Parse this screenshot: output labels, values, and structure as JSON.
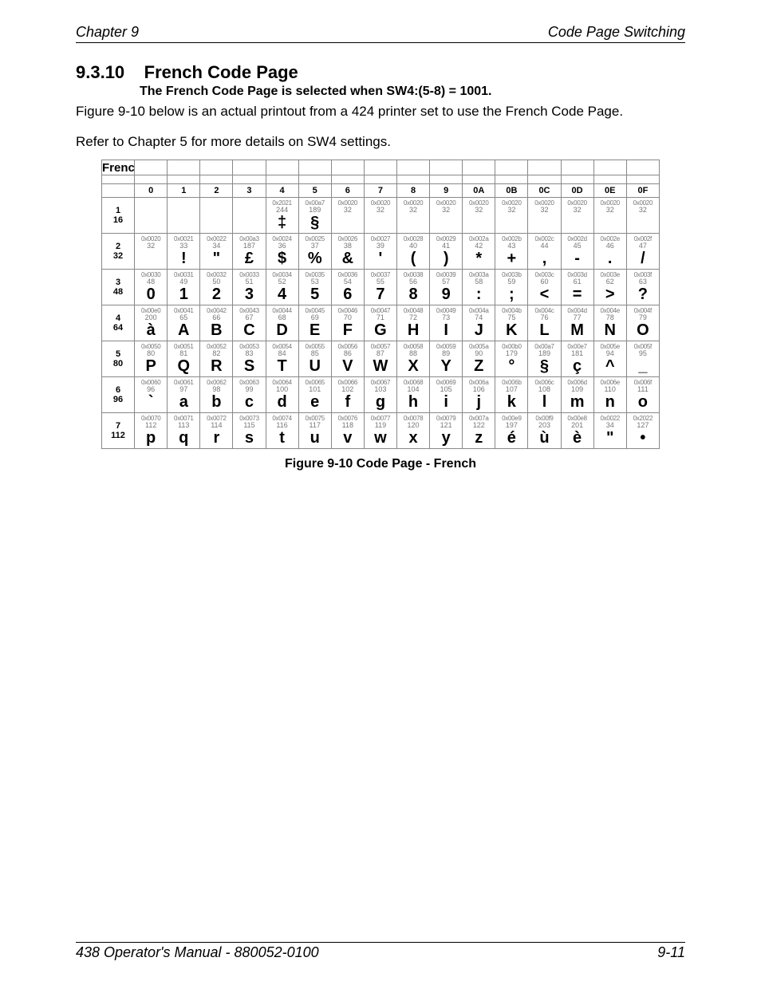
{
  "header": {
    "left": "Chapter 9",
    "right": "Code Page Switching"
  },
  "footer": {
    "left": "438 Operator's Manual - 880052-0100",
    "right": "9-11"
  },
  "section": {
    "number": "9.3.10",
    "title": "French Code Page",
    "subtitle": "The French Code Page is selected when SW4:(5-8) = 1001.",
    "para1": "Figure 9-10 below is an actual printout from a 424 printer set to use the French Code Page.",
    "para2": "Refer to Chapter 5 for more details on SW4 settings."
  },
  "table": {
    "title": "French",
    "col_headers": [
      "0",
      "1",
      "2",
      "3",
      "4",
      "5",
      "6",
      "7",
      "8",
      "9",
      "0A",
      "0B",
      "0C",
      "0D",
      "0E",
      "0F"
    ],
    "rows": [
      {
        "n1": "1",
        "n2": "16",
        "cells": [
          null,
          null,
          null,
          null,
          {
            "hex": "0x2021",
            "dec": "244",
            "g": "‡"
          },
          {
            "hex": "0x00a7",
            "dec": "189",
            "g": "§"
          },
          {
            "hex": "0x0020",
            "dec": "32",
            "g": " "
          },
          {
            "hex": "0x0020",
            "dec": "32",
            "g": " "
          },
          {
            "hex": "0x0020",
            "dec": "32",
            "g": " "
          },
          {
            "hex": "0x0020",
            "dec": "32",
            "g": " "
          },
          {
            "hex": "0x0020",
            "dec": "32",
            "g": " "
          },
          {
            "hex": "0x0020",
            "dec": "32",
            "g": " "
          },
          {
            "hex": "0x0020",
            "dec": "32",
            "g": " "
          },
          {
            "hex": "0x0020",
            "dec": "32",
            "g": " "
          },
          {
            "hex": "0x0020",
            "dec": "32",
            "g": " "
          },
          {
            "hex": "0x0020",
            "dec": "32",
            "g": " "
          }
        ]
      },
      {
        "n1": "2",
        "n2": "32",
        "cells": [
          {
            "hex": "0x0020",
            "dec": "32",
            "g": " "
          },
          {
            "hex": "0x0021",
            "dec": "33",
            "g": "!"
          },
          {
            "hex": "0x0022",
            "dec": "34",
            "g": "\""
          },
          {
            "hex": "0x00a3",
            "dec": "187",
            "g": "£"
          },
          {
            "hex": "0x0024",
            "dec": "36",
            "g": "$"
          },
          {
            "hex": "0x0025",
            "dec": "37",
            "g": "%"
          },
          {
            "hex": "0x0026",
            "dec": "38",
            "g": "&"
          },
          {
            "hex": "0x0027",
            "dec": "39",
            "g": "'"
          },
          {
            "hex": "0x0028",
            "dec": "40",
            "g": "("
          },
          {
            "hex": "0x0029",
            "dec": "41",
            "g": ")"
          },
          {
            "hex": "0x002a",
            "dec": "42",
            "g": "*"
          },
          {
            "hex": "0x002b",
            "dec": "43",
            "g": "+"
          },
          {
            "hex": "0x002c",
            "dec": "44",
            "g": ","
          },
          {
            "hex": "0x002d",
            "dec": "45",
            "g": "-"
          },
          {
            "hex": "0x002e",
            "dec": "46",
            "g": "."
          },
          {
            "hex": "0x002f",
            "dec": "47",
            "g": "/"
          }
        ]
      },
      {
        "n1": "3",
        "n2": "48",
        "cells": [
          {
            "hex": "0x0030",
            "dec": "48",
            "g": "0"
          },
          {
            "hex": "0x0031",
            "dec": "49",
            "g": "1"
          },
          {
            "hex": "0x0032",
            "dec": "50",
            "g": "2"
          },
          {
            "hex": "0x0033",
            "dec": "51",
            "g": "3"
          },
          {
            "hex": "0x0034",
            "dec": "52",
            "g": "4"
          },
          {
            "hex": "0x0035",
            "dec": "53",
            "g": "5"
          },
          {
            "hex": "0x0036",
            "dec": "54",
            "g": "6"
          },
          {
            "hex": "0x0037",
            "dec": "55",
            "g": "7"
          },
          {
            "hex": "0x0038",
            "dec": "56",
            "g": "8"
          },
          {
            "hex": "0x0039",
            "dec": "57",
            "g": "9"
          },
          {
            "hex": "0x003a",
            "dec": "58",
            "g": ":"
          },
          {
            "hex": "0x003b",
            "dec": "59",
            "g": ";"
          },
          {
            "hex": "0x003c",
            "dec": "60",
            "g": "<"
          },
          {
            "hex": "0x003d",
            "dec": "61",
            "g": "="
          },
          {
            "hex": "0x003e",
            "dec": "62",
            "g": ">"
          },
          {
            "hex": "0x003f",
            "dec": "63",
            "g": "?"
          }
        ]
      },
      {
        "n1": "4",
        "n2": "64",
        "cells": [
          {
            "hex": "0x00e0",
            "dec": "200",
            "g": "à"
          },
          {
            "hex": "0x0041",
            "dec": "65",
            "g": "A"
          },
          {
            "hex": "0x0042",
            "dec": "66",
            "g": "B"
          },
          {
            "hex": "0x0043",
            "dec": "67",
            "g": "C"
          },
          {
            "hex": "0x0044",
            "dec": "68",
            "g": "D"
          },
          {
            "hex": "0x0045",
            "dec": "69",
            "g": "E"
          },
          {
            "hex": "0x0046",
            "dec": "70",
            "g": "F"
          },
          {
            "hex": "0x0047",
            "dec": "71",
            "g": "G"
          },
          {
            "hex": "0x0048",
            "dec": "72",
            "g": "H"
          },
          {
            "hex": "0x0049",
            "dec": "73",
            "g": "I"
          },
          {
            "hex": "0x004a",
            "dec": "74",
            "g": "J"
          },
          {
            "hex": "0x004b",
            "dec": "75",
            "g": "K"
          },
          {
            "hex": "0x004c",
            "dec": "76",
            "g": "L"
          },
          {
            "hex": "0x004d",
            "dec": "77",
            "g": "M"
          },
          {
            "hex": "0x004e",
            "dec": "78",
            "g": "N"
          },
          {
            "hex": "0x004f",
            "dec": "79",
            "g": "O"
          }
        ]
      },
      {
        "n1": "5",
        "n2": "80",
        "cells": [
          {
            "hex": "0x0050",
            "dec": "80",
            "g": "P"
          },
          {
            "hex": "0x0051",
            "dec": "81",
            "g": "Q"
          },
          {
            "hex": "0x0052",
            "dec": "82",
            "g": "R"
          },
          {
            "hex": "0x0053",
            "dec": "83",
            "g": "S"
          },
          {
            "hex": "0x0054",
            "dec": "84",
            "g": "T"
          },
          {
            "hex": "0x0055",
            "dec": "85",
            "g": "U"
          },
          {
            "hex": "0x0056",
            "dec": "86",
            "g": "V"
          },
          {
            "hex": "0x0057",
            "dec": "87",
            "g": "W"
          },
          {
            "hex": "0x0058",
            "dec": "88",
            "g": "X"
          },
          {
            "hex": "0x0059",
            "dec": "89",
            "g": "Y"
          },
          {
            "hex": "0x005a",
            "dec": "90",
            "g": "Z"
          },
          {
            "hex": "0x00b0",
            "dec": "179",
            "g": "°"
          },
          {
            "hex": "0x00a7",
            "dec": "189",
            "g": "§"
          },
          {
            "hex": "0x00e7",
            "dec": "181",
            "g": "ç"
          },
          {
            "hex": "0x005e",
            "dec": "94",
            "g": "^"
          },
          {
            "hex": "0x005f",
            "dec": "95",
            "g": "_"
          }
        ]
      },
      {
        "n1": "6",
        "n2": "96",
        "cells": [
          {
            "hex": "0x0060",
            "dec": "96",
            "g": "`"
          },
          {
            "hex": "0x0061",
            "dec": "97",
            "g": "a"
          },
          {
            "hex": "0x0062",
            "dec": "98",
            "g": "b"
          },
          {
            "hex": "0x0063",
            "dec": "99",
            "g": "c"
          },
          {
            "hex": "0x0064",
            "dec": "100",
            "g": "d"
          },
          {
            "hex": "0x0065",
            "dec": "101",
            "g": "e"
          },
          {
            "hex": "0x0066",
            "dec": "102",
            "g": "f"
          },
          {
            "hex": "0x0067",
            "dec": "103",
            "g": "g"
          },
          {
            "hex": "0x0068",
            "dec": "104",
            "g": "h"
          },
          {
            "hex": "0x0069",
            "dec": "105",
            "g": "i"
          },
          {
            "hex": "0x006a",
            "dec": "106",
            "g": "j"
          },
          {
            "hex": "0x006b",
            "dec": "107",
            "g": "k"
          },
          {
            "hex": "0x006c",
            "dec": "108",
            "g": "l"
          },
          {
            "hex": "0x006d",
            "dec": "109",
            "g": "m"
          },
          {
            "hex": "0x006e",
            "dec": "110",
            "g": "n"
          },
          {
            "hex": "0x006f",
            "dec": "111",
            "g": "o"
          }
        ]
      },
      {
        "n1": "7",
        "n2": "112",
        "cells": [
          {
            "hex": "0x0070",
            "dec": "112",
            "g": "p"
          },
          {
            "hex": "0x0071",
            "dec": "113",
            "g": "q"
          },
          {
            "hex": "0x0072",
            "dec": "114",
            "g": "r"
          },
          {
            "hex": "0x0073",
            "dec": "115",
            "g": "s"
          },
          {
            "hex": "0x0074",
            "dec": "116",
            "g": "t"
          },
          {
            "hex": "0x0075",
            "dec": "117",
            "g": "u"
          },
          {
            "hex": "0x0076",
            "dec": "118",
            "g": "v"
          },
          {
            "hex": "0x0077",
            "dec": "119",
            "g": "w"
          },
          {
            "hex": "0x0078",
            "dec": "120",
            "g": "x"
          },
          {
            "hex": "0x0079",
            "dec": "121",
            "g": "y"
          },
          {
            "hex": "0x007a",
            "dec": "122",
            "g": "z"
          },
          {
            "hex": "0x00e9",
            "dec": "197",
            "g": "é"
          },
          {
            "hex": "0x00f9",
            "dec": "203",
            "g": "ù"
          },
          {
            "hex": "0x00e8",
            "dec": "201",
            "g": "è"
          },
          {
            "hex": "0x0022",
            "dec": "34",
            "g": "\""
          },
          {
            "hex": "0x2022",
            "dec": "127",
            "g": "•"
          }
        ]
      }
    ]
  },
  "figure_caption": "Figure 9-10  Code Page - French"
}
